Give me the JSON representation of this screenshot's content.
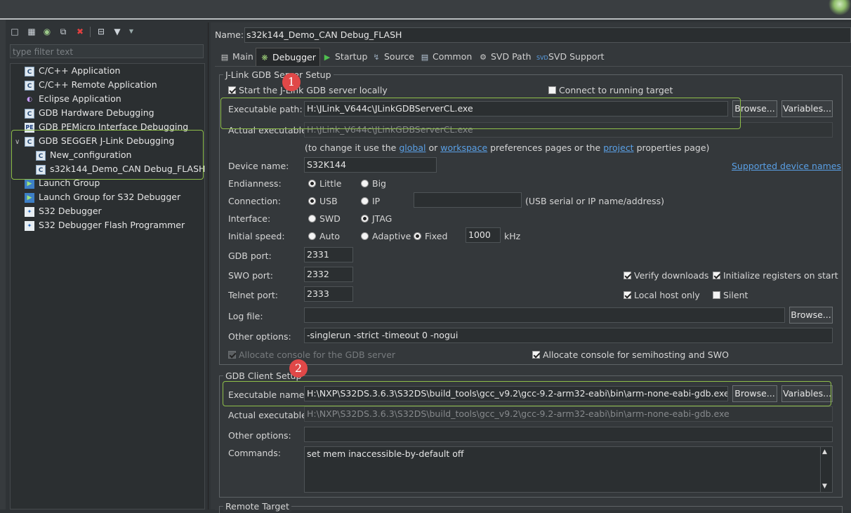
{
  "left": {
    "filter_placeholder": "type filter text",
    "tree": [
      {
        "label": "C/C++ Application",
        "icon": "c-app-icon"
      },
      {
        "label": "C/C++ Remote Application",
        "icon": "c-app-icon"
      },
      {
        "label": "Eclipse Application",
        "icon": "eclipse-icon"
      },
      {
        "label": "GDB Hardware Debugging",
        "icon": "c-app-icon"
      },
      {
        "label": "GDB PEMicro Interface Debugging",
        "icon": "pe-icon"
      },
      {
        "label": "GDB SEGGER J-Link Debugging",
        "icon": "c-app-icon"
      },
      {
        "label": "New_configuration",
        "icon": "c-app-icon"
      },
      {
        "label": "s32k144_Demo_CAN Debug_FLASH",
        "icon": "c-app-icon"
      },
      {
        "label": "Launch Group",
        "icon": "launch-group-icon"
      },
      {
        "label": "Launch Group for S32 Debugger",
        "icon": "launch-group-icon"
      },
      {
        "label": "S32 Debugger",
        "icon": "s32-icon"
      },
      {
        "label": "S32 Debugger Flash Programmer",
        "icon": "s32-icon"
      }
    ]
  },
  "name_label": "Name:",
  "name_value": "s32k144_Demo_CAN Debug_FLASH",
  "tabs": [
    "Main",
    "Debugger",
    "Startup",
    "Source",
    "Common",
    "SVD Path",
    "SVD Support"
  ],
  "server": {
    "group_label": "J-Link GDB Server Setup",
    "start_local": "Start the J-Link GDB server locally",
    "connect_running": "Connect to running target",
    "exec_path_label": "Executable path:",
    "exec_path_value": "H:\\JLink_V644c\\JLinkGDBServerCL.exe",
    "browse": "Browse...",
    "variables": "Variables...",
    "actual_exec_label": "Actual executable:",
    "actual_exec_value": "H:\\JLink_V644c\\JLinkGDBServerCL.exe",
    "hint_1": "(to change it use the",
    "hint_global": "global",
    "hint_or": "or",
    "hint_workspace": "workspace",
    "hint_2": "preferences pages or the",
    "hint_project": "project",
    "hint_3": "properties page)",
    "device_label": "Device name:",
    "device_value": "S32K144",
    "supported_link": "Supported device names",
    "endian_label": "Endianness:",
    "endian_little": "Little",
    "endian_big": "Big",
    "conn_label": "Connection:",
    "conn_usb": "USB",
    "conn_ip": "IP",
    "conn_hint": "(USB serial or IP name/address)",
    "iface_label": "Interface:",
    "iface_swd": "SWD",
    "iface_jtag": "JTAG",
    "speed_label": "Initial speed:",
    "speed_auto": "Auto",
    "speed_adaptive": "Adaptive",
    "speed_fixed": "Fixed",
    "speed_value": "1000",
    "speed_unit": "kHz",
    "gdb_port_label": "GDB port:",
    "gdb_port": "2331",
    "swo_port_label": "SWO port:",
    "swo_port": "2332",
    "telnet_label": "Telnet port:",
    "telnet_port": "2333",
    "verify": "Verify downloads",
    "init_regs": "Initialize registers on start",
    "local_only": "Local host only",
    "silent": "Silent",
    "log_label": "Log file:",
    "other_label": "Other options:",
    "other_value": "-singlerun -strict -timeout 0 -nogui",
    "alloc_gdb": "Allocate console for the GDB server",
    "alloc_semi": "Allocate console for semihosting and SWO"
  },
  "client": {
    "group_label": "GDB Client Setup",
    "exec_name_label": "Executable name:",
    "exec_name_value": "H:\\NXP\\S32DS.3.6.3\\S32DS\\build_tools\\gcc_v9.2\\gcc-9.2-arm32-eabi\\bin\\arm-none-eabi-gdb.exe",
    "browse": "Browse...",
    "variables": "Variables...",
    "actual_exec_label": "Actual executable:",
    "actual_exec_value": "H:\\NXP\\S32DS.3.6.3\\S32DS\\build_tools\\gcc_v9.2\\gcc-9.2-arm32-eabi\\bin\\arm-none-eabi-gdb.exe",
    "other_label": "Other options:",
    "commands_label": "Commands:",
    "commands_value": "set mem inaccessible-by-default off"
  },
  "remote_label": "Remote Target",
  "annotations": {
    "one": "1",
    "two": "2",
    "color_box": "#8fbf4a",
    "color_badge": "#e04848"
  }
}
